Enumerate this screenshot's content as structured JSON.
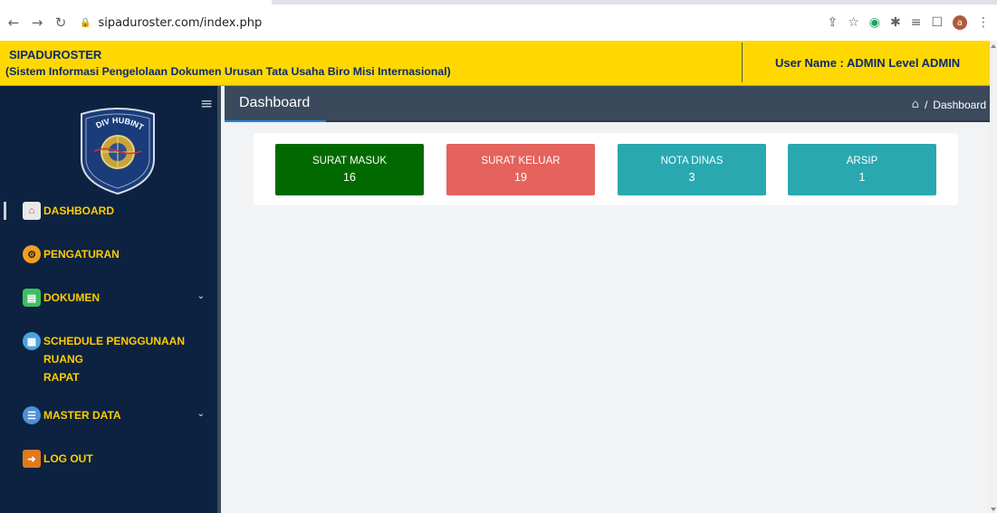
{
  "browser": {
    "url": "sipaduroster.com/index.php",
    "avatar_letter": "a"
  },
  "header": {
    "title": "SIPADUROSTER",
    "subtitle": "(Sistem Informasi Pengelolaan Dokumen Urusan Tata Usaha Biro Misi Internasional)",
    "user": "User Name : ADMIN Level ADMIN",
    "bg_color": "#ffd800"
  },
  "sidebar": {
    "logo_text": "DIV HUBINTER",
    "items": [
      {
        "label": "DASHBOARD",
        "icon": "home-icon"
      },
      {
        "label": "PENGATURAN",
        "icon": "settings-user-icon"
      },
      {
        "label": "DOKUMEN",
        "icon": "document-icon"
      },
      {
        "label": "SCHEDULE PENGGUNAAN RUANG\nRAPAT",
        "icon": "calendar-icon"
      },
      {
        "label": "MASTER DATA",
        "icon": "database-icon"
      },
      {
        "label": "LOG OUT",
        "icon": "logout-door-icon"
      }
    ]
  },
  "main": {
    "page_title": "Dashboard",
    "breadcrumb": "Dashboard",
    "tiles": [
      {
        "label": "SURAT MASUK",
        "count": "16",
        "color": "#006a00"
      },
      {
        "label": "SURAT KELUAR",
        "count": "19",
        "color": "#e4635c"
      },
      {
        "label": "NOTA DINAS",
        "count": "3",
        "color": "#2aa8b0"
      },
      {
        "label": "ARSIP",
        "count": "1",
        "color": "#2aa8b0"
      }
    ]
  }
}
